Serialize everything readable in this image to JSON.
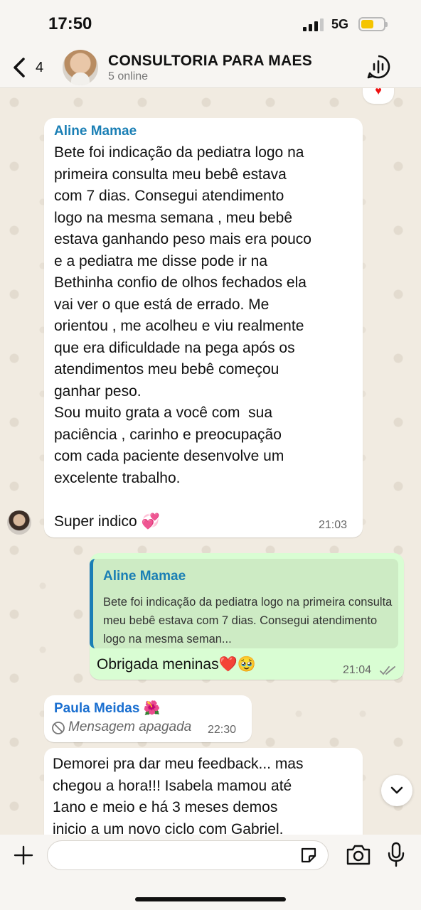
{
  "status_bar": {
    "time": "17:50",
    "network": "5G"
  },
  "header": {
    "back_count": "4",
    "group_name": "CONSULTORIA PARA MAES",
    "subtitle": "5 online"
  },
  "messages": [
    {
      "sender": "Aline Mamae",
      "text": "Bete foi indicação da pediatra logo na\nprimeira consulta meu bebê estava\ncom 7 dias. Consegui atendimento\nlogo na mesma semana , meu bebê\nestava ganhando peso mais era pouco\ne a pediatra me disse pode ir na\nBethinha confio de olhos fechados ela\nvai ver o que está de errado. Me\norientou , me acolheu e viu realmente\nque era dificuldade na pega após os\natendimentos meu bebê começou\nganhar peso.\nSou muito grata a você com  sua\npaciência , carinho e preocupação\ncom cada paciente desenvolve um\nexcelente trabalho.\n\nSuper indico 💞",
      "time": "21:03"
    },
    {
      "quote_sender": "Aline Mamae",
      "quote_text": "Bete foi indicação da pediatra logo na primeira consulta meu bebê estava com 7 dias. Consegui atendimento logo na mesma seman...",
      "text": "Obrigada meninas❤️🥹",
      "time": "21:04"
    },
    {
      "sender": "Paula Meidas 🌺",
      "text": "Mensagem apagada",
      "time": "22:30"
    },
    {
      "text": "Demorei pra dar meu feedback... mas\nchegou a hora!!! Isabela mamou até\n1ano e meio e há 3 meses demos\ninicio a um novo ciclo com Gabriel."
    }
  ]
}
